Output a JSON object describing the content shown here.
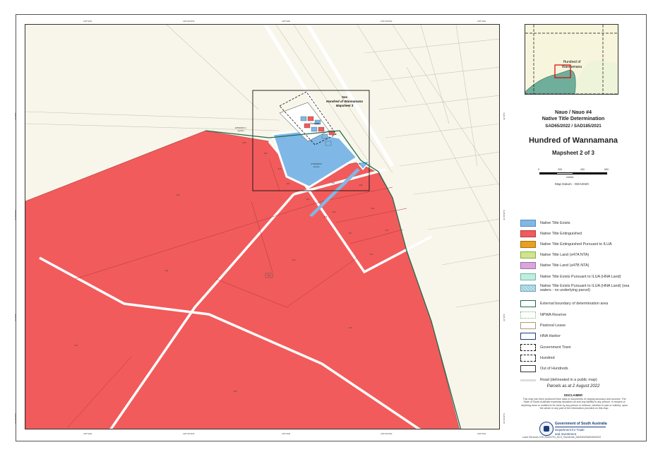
{
  "map": {
    "see_note": [
      "See",
      "Hundred of Wannamana",
      "Mapsheet 3"
    ],
    "labels": {
      "township_label": "Kowulka",
      "reserve_upper": "APPENDIX 1",
      "reserve_upper_sub": "section",
      "reserve_main": "STANDARD",
      "reserve_main_sub": "section"
    },
    "parcel_ids": [
      "308",
      "309",
      "310",
      "303",
      "302",
      "301",
      "300",
      "306",
      "304",
      "305",
      "307",
      "311",
      "312",
      "313",
      "314",
      "315",
      "316",
      "317",
      "318",
      "319",
      "320"
    ],
    "ticks_top": [
      "135°32'E",
      "135°32'30\"E",
      "135°33'E",
      "135°33'30\"E",
      "135°34'E"
    ],
    "ticks_bottom": [
      "135°32'E",
      "135°32'30\"E",
      "135°33'E",
      "135°33'30\"E",
      "135°34'E"
    ],
    "ticks_left": [
      "32°48'S",
      "32°48'30\"S",
      "32°49'S",
      "32°49'30\"S"
    ],
    "ticks_right": [
      "32°48'S",
      "32°48'30\"S",
      "32°49'S",
      "32°49'30\"S"
    ]
  },
  "inset": {
    "label_line1": "Hundred of",
    "label_line2": "Wannamana"
  },
  "panel": {
    "claim_title_1": "Nauo / Nauo #4",
    "claim_title_2": "Native Title Determination",
    "claim_numbers": "SAD65/2022 / SAD185/2021",
    "hundred_title": "Hundred of Wannamana",
    "mapsheet": "Mapsheet 2 of 3",
    "scale_ticks": [
      "0",
      "200",
      "400",
      "600"
    ],
    "scale_unit": "metres",
    "datum": "Map Datum : GDA2020",
    "parcels_date": "Parcels as at 2 August 2022",
    "disclaimer_title": "DISCLAIMER",
    "disclaimer_text": "This map has been produced from data or documents of varying accuracy and sources. The State of South Australia expressly disclaims all and any liability to any person, in respect of anything done or omitted to be done by any person in reliance, whether in part or entirely, upon the whole or any part of the information provided on this map.",
    "gov_line1": "Government of South Australia",
    "gov_line2": "Department for Trade",
    "gov_line3": "and Investment"
  },
  "legend": [
    {
      "label": "Native Title Exists",
      "fill": "#7fb8e6",
      "border": "#5a8ab6",
      "style": "solid"
    },
    {
      "label": "Native Title Extinguished",
      "fill": "#f25b5b",
      "border": "#b03b3b",
      "style": "solid"
    },
    {
      "label": "Native Title Extinguished Pursuant to ILUA",
      "fill": "#e8a020",
      "border": "#a87010",
      "style": "solid"
    },
    {
      "label": "Native Title Land (s47A NTA)",
      "fill": "#cfe58a",
      "border": "#8fa850",
      "style": "solid"
    },
    {
      "label": "Native Title Land (s47B NTA)",
      "fill": "#d8a6dc",
      "border": "#a070a8",
      "style": "solid"
    },
    {
      "label": "Native Title Exists Pursuant to ILUA (HNA Land)",
      "fill": "#bfeee0",
      "border": "#6fb8a0",
      "style": "solid"
    },
    {
      "label": "Native Title Exists Pursuant to ILUA (HNA Land) (sea waters - no underlying parcel)",
      "fill": "#bfe4ee",
      "border": "#6fa0b8",
      "style": "wave"
    },
    {
      "label": "External boundary of determination area",
      "fill": "#ffffff",
      "border": "#1f6b4f",
      "style": "thick"
    },
    {
      "label": "NPWA Reserve",
      "fill": "#ffffff",
      "border": "#7fae6f",
      "style": "dotted"
    },
    {
      "label": "Pastoral Lease",
      "fill": "#ffffff",
      "border": "#a89a7a",
      "style": "solid"
    },
    {
      "label": "HNA Harbor",
      "fill": "#ffffff",
      "border": "#1a3d7a",
      "style": "thick"
    },
    {
      "label": "Government Town",
      "fill": "#ffffff",
      "border": "#111111",
      "style": "dashed"
    },
    {
      "label": "Hundred",
      "fill": "#ffffff",
      "border": "#111111",
      "style": "dashdot"
    },
    {
      "label": "Out of Hundreds",
      "fill": "#ffffff",
      "border": "#333333",
      "style": "solid"
    },
    {
      "label": "Road (delineated in a public map)",
      "fill": "#dddddd",
      "border": "#dddddd",
      "style": "line"
    }
  ],
  "footer": "Land Services GIS  20220701_DLS_Hundreds_NA0049/SA0049/2022",
  "colors": {
    "extinguished": "#f25b5b",
    "exists": "#7fb8e6",
    "background": "#f8f6ea",
    "boundary": "#1f6b4f"
  }
}
